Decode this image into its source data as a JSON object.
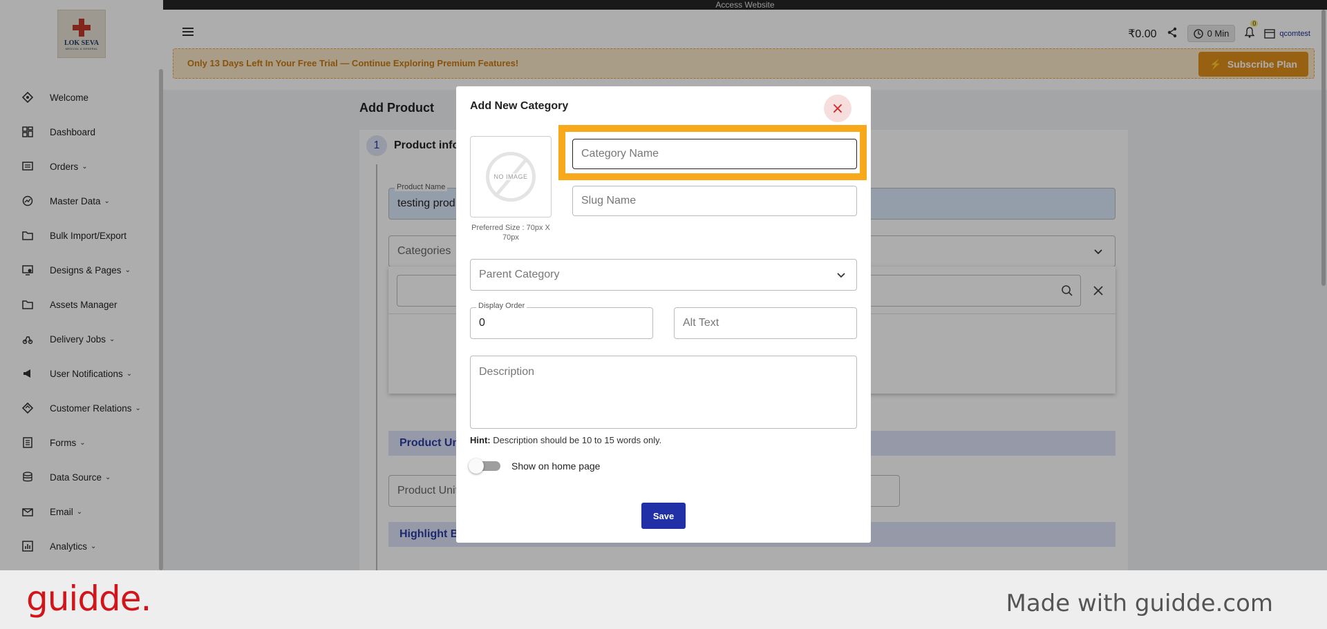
{
  "topbar": {
    "label": "Access Website"
  },
  "sidebar": {
    "logo_line1": "LOK SEVA",
    "logo_line2": "MEDICAL & GENERAL",
    "items": [
      {
        "label": "Welcome",
        "icon": "welcome-icon"
      },
      {
        "label": "Dashboard",
        "icon": "dashboard-icon"
      },
      {
        "label": "Orders",
        "icon": "orders-icon",
        "chevron": "⌄"
      },
      {
        "label": "Master Data",
        "icon": "master-data-icon",
        "chevron": "⌄"
      },
      {
        "label": "Bulk Import/Export",
        "icon": "folder-icon"
      },
      {
        "label": "Designs & Pages",
        "icon": "designs-icon",
        "chevron": "⌄"
      },
      {
        "label": "Assets Manager",
        "icon": "folder-icon"
      },
      {
        "label": "Delivery Jobs",
        "icon": "delivery-icon",
        "chevron": "⌄"
      },
      {
        "label": "User Notifications",
        "icon": "megaphone-icon",
        "chevron": "⌄"
      },
      {
        "label": "Customer Relations",
        "icon": "handshake-icon",
        "chevron": "⌄"
      },
      {
        "label": "Forms",
        "icon": "forms-icon",
        "chevron": "⌄"
      },
      {
        "label": "Data Source",
        "icon": "database-icon",
        "chevron": "⌄"
      },
      {
        "label": "Email",
        "icon": "email-icon",
        "chevron": "⌄"
      },
      {
        "label": "Analytics",
        "icon": "analytics-icon",
        "chevron": "⌄"
      }
    ]
  },
  "header": {
    "balance": "₹0.00",
    "timer": "0 Min",
    "notifications_count": "0",
    "username": "qcomtest",
    "trial_message": "Only 13 Days Left In Your Free Trial — Continue Exploring Premium Features!",
    "subscribe_label": "Subscribe Plan"
  },
  "page": {
    "title": "Add Product",
    "step_number": "1",
    "step_label": "Product info",
    "product_name_label": "Product Name",
    "product_name_value": "testing prod",
    "categories_placeholder": "Categories",
    "product_unit_section": "Product Uni",
    "product_unit_placeholder": "Product Unit",
    "highlight_section": "Highlight Ba"
  },
  "modal": {
    "title": "Add New Category",
    "close_glyph": "×",
    "no_image_text": "NO IMAGE",
    "image_hint": "Preferred Size : 70px X 70px",
    "category_name_placeholder": "Category Name",
    "slug_placeholder": "Slug Name",
    "parent_category_placeholder": "Parent Category",
    "display_order_label": "Display Order",
    "display_order_value": "0",
    "alt_text_placeholder": "Alt Text",
    "description_placeholder": "Description",
    "hint_label": "Hint:",
    "hint_text": "Description should be 10 to 15 words only.",
    "show_home_label": "Show on home page",
    "save_label": "Save"
  },
  "footer": {
    "brand": "guidde.",
    "made_with": "Made with guidde.com"
  },
  "colors": {
    "accent": "#2230a8",
    "highlight": "#f7a81b",
    "trial_text": "#c77a13",
    "subscribe_bg": "#e0901a",
    "brand_red": "#d0161b"
  }
}
